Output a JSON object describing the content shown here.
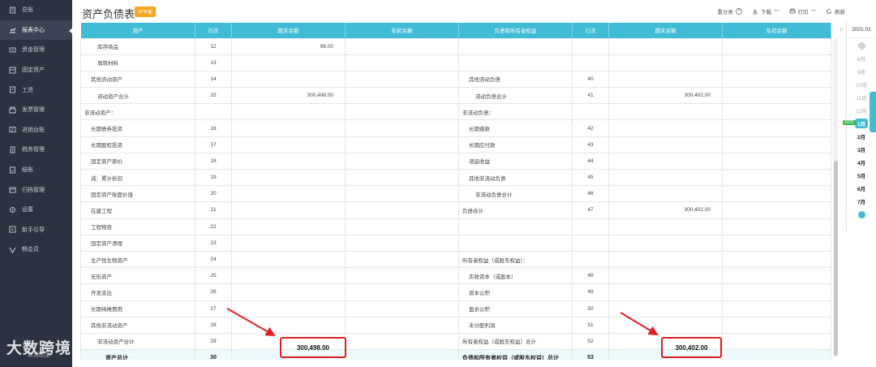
{
  "sidebar": {
    "items": [
      {
        "label": "总账",
        "icon": "ledger-icon"
      },
      {
        "label": "报表中心",
        "icon": "chart-icon",
        "active": true
      },
      {
        "label": "资金管理",
        "icon": "money-icon"
      },
      {
        "label": "固定资产",
        "icon": "asset-icon"
      },
      {
        "label": "工资",
        "icon": "salary-icon"
      },
      {
        "label": "发票管理",
        "icon": "invoice-icon"
      },
      {
        "label": "进销台账",
        "icon": "inventory-icon"
      },
      {
        "label": "税务管理",
        "icon": "tax-icon"
      },
      {
        "label": "结账",
        "icon": "close-books-icon"
      },
      {
        "label": "归档管理",
        "icon": "archive-icon"
      },
      {
        "label": "设置",
        "icon": "settings-icon"
      },
      {
        "label": "新手引导",
        "icon": "guide-icon"
      },
      {
        "label": "畅会员",
        "icon": "vip-icon"
      }
    ],
    "bottom_label": "取消固定"
  },
  "header": {
    "title": "资产负债表",
    "badge": "不平衡",
    "toolbar": {
      "reclassify": "重分类",
      "help": "?",
      "download": "下载",
      "print": "打印",
      "refresh": "刷新"
    }
  },
  "table": {
    "headers": [
      "资产",
      "行次",
      "期末余额",
      "年初余额",
      "负债和所有者权益",
      "行次",
      "期末余额",
      "年初余额"
    ],
    "rows": [
      {
        "a": "库存商品",
        "ai": 2,
        "an": "12",
        "av": "96.00",
        "l": "",
        "li": 0,
        "ln": "",
        "lv": ""
      },
      {
        "a": "周转材料",
        "ai": 2,
        "an": "13",
        "av": "",
        "l": "",
        "li": 0,
        "ln": "",
        "lv": ""
      },
      {
        "a": "其他流动资产",
        "ai": 1,
        "an": "14",
        "av": "",
        "l": "其他流动负债",
        "li": 1,
        "ln": "40",
        "lv": ""
      },
      {
        "a": "流动资产合计",
        "ai": 2,
        "an": "15",
        "av": "300,498.00",
        "l": "流动负债合计",
        "li": 2,
        "ln": "41",
        "lv": "300,402.00"
      },
      {
        "a": "非流动资产：",
        "ai": 0,
        "an": "",
        "av": "",
        "l": "非流动负债：",
        "li": 0,
        "ln": "",
        "lv": ""
      },
      {
        "a": "长期债券投资",
        "ai": 1,
        "an": "16",
        "av": "",
        "l": "长期借款",
        "li": 1,
        "ln": "42",
        "lv": ""
      },
      {
        "a": "长期股权投资",
        "ai": 1,
        "an": "17",
        "av": "",
        "l": "长期应付款",
        "li": 1,
        "ln": "43",
        "lv": ""
      },
      {
        "a": "固定资产原价",
        "ai": 1,
        "an": "18",
        "av": "",
        "l": "递延收益",
        "li": 1,
        "ln": "44",
        "lv": ""
      },
      {
        "a": "减：累计折旧",
        "ai": 1,
        "an": "19",
        "av": "",
        "l": "其他非流动负债",
        "li": 1,
        "ln": "45",
        "lv": ""
      },
      {
        "a": "固定资产账面价值",
        "ai": 1,
        "an": "20",
        "av": "",
        "l": "非流动负债合计",
        "li": 2,
        "ln": "46",
        "lv": ""
      },
      {
        "a": "在建工程",
        "ai": 1,
        "an": "21",
        "av": "",
        "l": "负债合计",
        "li": 0,
        "ln": "47",
        "lv": "300,402.00"
      },
      {
        "a": "工程物资",
        "ai": 1,
        "an": "22",
        "av": "",
        "l": "",
        "li": 0,
        "ln": "",
        "lv": ""
      },
      {
        "a": "固定资产清理",
        "ai": 1,
        "an": "23",
        "av": "",
        "l": "",
        "li": 0,
        "ln": "",
        "lv": ""
      },
      {
        "a": "生产性生物资产",
        "ai": 1,
        "an": "24",
        "av": "",
        "l": "所有者权益（或股东权益）：",
        "li": 0,
        "ln": "",
        "lv": ""
      },
      {
        "a": "无形资产",
        "ai": 1,
        "an": "25",
        "av": "",
        "l": "实收资本（或股本）",
        "li": 1,
        "ln": "48",
        "lv": ""
      },
      {
        "a": "开发支出",
        "ai": 1,
        "an": "26",
        "av": "",
        "l": "资本公积",
        "li": 1,
        "ln": "49",
        "lv": ""
      },
      {
        "a": "长期待摊费用",
        "ai": 1,
        "an": "27",
        "av": "",
        "l": "盈余公积",
        "li": 1,
        "ln": "50",
        "lv": ""
      },
      {
        "a": "其他非流动资产",
        "ai": 1,
        "an": "28",
        "av": "",
        "l": "未分配利润",
        "li": 1,
        "ln": "51",
        "lv": ""
      },
      {
        "a": "非流动资产合计",
        "ai": 2,
        "an": "29",
        "av": "",
        "l": "所有者权益（或股东权益）合计",
        "li": 0,
        "ln": "52",
        "lv": ""
      }
    ],
    "total": {
      "a": "资产总计",
      "an": "30",
      "av": "300,498.00",
      "l": "负债和所有者权益（或股东权益）总计",
      "ln": "53",
      "lv": "300,402.00"
    }
  },
  "date_panel": {
    "current": "2021.01",
    "prev_months": [
      "8月",
      "9月",
      "10月",
      "11月",
      "12月"
    ],
    "year_tag": "2021",
    "months": [
      "1月",
      "2月",
      "3月",
      "4月",
      "5月",
      "6月",
      "7月"
    ],
    "selected": "1月"
  },
  "watermark": "大数跨境",
  "colors": {
    "header_bg": "#41bcd6",
    "sidebar_bg": "#2d3240",
    "highlight": "#e02020",
    "badge": "#f5a623"
  }
}
